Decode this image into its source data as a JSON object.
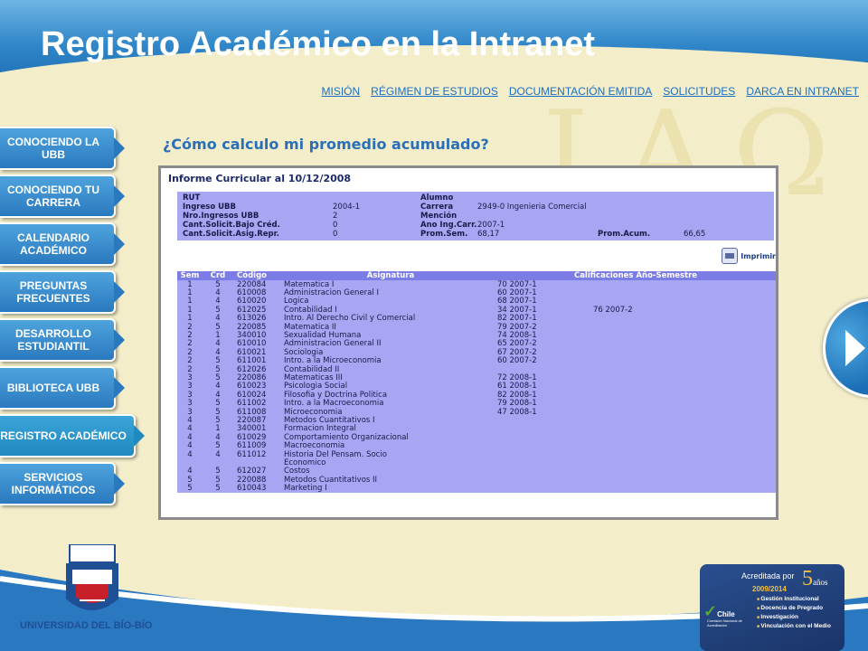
{
  "header": {
    "title": "Registro Académico en la Intranet"
  },
  "topnav": [
    {
      "label": "MISIÓN"
    },
    {
      "label": "RÉGIMEN DE ESTUDIOS"
    },
    {
      "label": "DOCUMENTACIÓN  EMITIDA"
    },
    {
      "label": "SOLICITUDES"
    },
    {
      "label": "DARCA  EN INTRANET"
    }
  ],
  "sidebar": [
    {
      "label": "CONOCIENDO LA UBB"
    },
    {
      "label": "CONOCIENDO TU CARRERA"
    },
    {
      "label": "CALENDARIO ACADÉMICO"
    },
    {
      "label": "PREGUNTAS FRECUENTES"
    },
    {
      "label": "DESARROLLO ESTUDIANTIL"
    },
    {
      "label": "BIBLIOTECA UBB"
    },
    {
      "label": "REGISTRO ACADÉMICO"
    },
    {
      "label": "SERVICIOS INFORMÁTICOS"
    }
  ],
  "subtitle": "¿Cómo calculo mi promedio acumulado?",
  "report": {
    "title": "Informe Curricular al 10/12/2008",
    "info": [
      [
        "RUT",
        "",
        "Alumno",
        "",
        "",
        ""
      ],
      [
        "Ingreso UBB",
        "2004-1",
        "Carrera",
        "2949-0 Ingenieria Comercial",
        "",
        ""
      ],
      [
        "Nro.Ingresos UBB",
        "2",
        "Mención",
        "",
        "",
        ""
      ],
      [
        "Cant.Solicit.Bajo Créd.",
        "0",
        "Ano Ing.Carr.",
        "2007-1",
        "",
        ""
      ],
      [
        "Cant.Solicit.Asig.Repr.",
        "0",
        "Prom.Sem.",
        "68,17",
        "Prom.Acum.",
        "66,65"
      ]
    ],
    "print_label": "Imprimir",
    "headers": {
      "sem": "Sem",
      "crd": "Crd",
      "codigo": "Código",
      "asignatura": "Asignatura",
      "calificaciones": "Calificaciones Año-Semestre"
    },
    "rows": [
      [
        "1",
        "5",
        "220084",
        "Matematica I",
        "70 2007-1",
        ""
      ],
      [
        "1",
        "4",
        "610008",
        "Administracion General I",
        "60 2007-1",
        ""
      ],
      [
        "1",
        "4",
        "610020",
        "Logica",
        "68 2007-1",
        ""
      ],
      [
        "1",
        "5",
        "612025",
        "Contabilidad I",
        "34 2007-1",
        "76 2007-2"
      ],
      [
        "1",
        "4",
        "613026",
        "Intro. Al Derecho Civil y Comercial",
        "82 2007-1",
        ""
      ],
      [
        "2",
        "5",
        "220085",
        "Matematica II",
        "79 2007-2",
        ""
      ],
      [
        "2",
        "1",
        "340010",
        "Sexualidad Humana",
        "74 2008-1",
        ""
      ],
      [
        "2",
        "4",
        "610010",
        "Administracion General II",
        "65 2007-2",
        ""
      ],
      [
        "2",
        "4",
        "610021",
        "Sociologia",
        "67 2007-2",
        ""
      ],
      [
        "2",
        "5",
        "611001",
        "Intro. a la Microeconomia",
        "60 2007-2",
        ""
      ],
      [
        "2",
        "5",
        "612026",
        "Contabilidad II",
        "",
        ""
      ],
      [
        "3",
        "5",
        "220086",
        "Matematicas III",
        "72 2008-1",
        ""
      ],
      [
        "3",
        "4",
        "610023",
        "Psicologia Social",
        "61 2008-1",
        ""
      ],
      [
        "3",
        "4",
        "610024",
        "Filosofia y Doctrina Politica",
        "82 2008-1",
        ""
      ],
      [
        "3",
        "5",
        "611002",
        "Intro. a la Macroeconomia",
        "79 2008-1",
        ""
      ],
      [
        "3",
        "5",
        "611008",
        "Microeconomia",
        "47 2008-1",
        ""
      ],
      [
        "4",
        "5",
        "220087",
        "Metodos Cuantitativos I",
        "",
        ""
      ],
      [
        "4",
        "1",
        "340001",
        "Formacion Integral",
        "",
        ""
      ],
      [
        "4",
        "4",
        "610029",
        "Comportamiento Organizacional",
        "",
        ""
      ],
      [
        "4",
        "5",
        "611009",
        "Macroeconomia",
        "",
        ""
      ],
      [
        "4",
        "4",
        "611012",
        "Historia Del Pensam. Socio",
        "",
        ""
      ],
      [
        "",
        "",
        "",
        "Economico",
        "",
        ""
      ],
      [
        "4",
        "5",
        "612027",
        "Costos",
        "",
        ""
      ],
      [
        "5",
        "5",
        "220088",
        "Metodos Cuantitativos II",
        "",
        ""
      ],
      [
        "5",
        "5",
        "610043",
        "Marketing I",
        "",
        ""
      ]
    ]
  },
  "logo": {
    "caption": "UNIVERSIDAD DEL BÍO-BÍO"
  },
  "accreditation": {
    "top": "Acreditada por",
    "years": "5",
    "years_unit": "años",
    "period": "2009/2014",
    "country": "Chile",
    "agency": "Comisión Nacional de Acreditación",
    "areas": [
      "Gestión Institucional",
      "Docencia de Pregrado",
      "Investigación",
      "Vinculación con el Medio"
    ]
  },
  "colors": {
    "banner": "#2f86c8",
    "background": "#f3edc9",
    "link": "#1a6fc4",
    "table": "#a6a6f2",
    "table_head": "#7c7ce6"
  },
  "icons": {
    "next": "arrow-right-icon",
    "print": "printer-icon"
  }
}
